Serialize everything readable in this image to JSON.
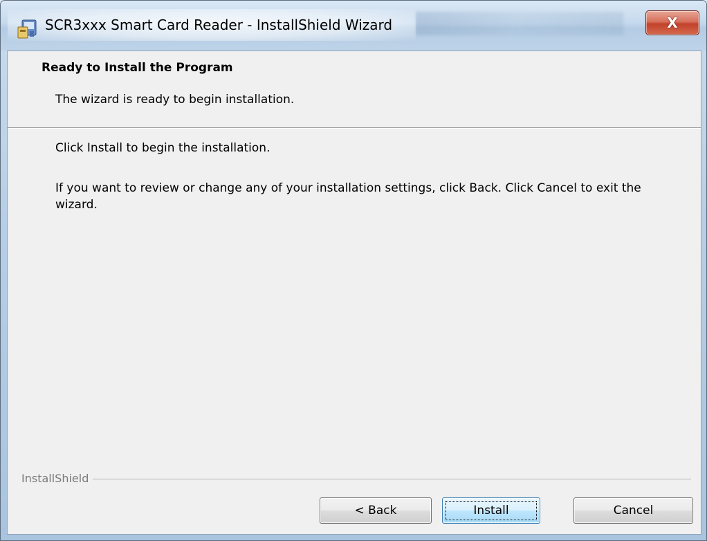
{
  "window": {
    "title": "SCR3xxx Smart Card Reader - InstallShield Wizard",
    "close_label": "X"
  },
  "header": {
    "title": "Ready to Install the Program",
    "subtitle": "The wizard is ready to begin installation."
  },
  "body": {
    "line1": "Click Install to begin the installation.",
    "line2": "If you want to review or change any of your installation settings, click Back. Click Cancel to exit the wizard."
  },
  "footer": {
    "brand": "InstallShield"
  },
  "buttons": {
    "back": "< Back",
    "install": "Install",
    "cancel": "Cancel"
  },
  "colors": {
    "titlebar": "#c5d9ed",
    "client_bg": "#f0f0f0",
    "close_red": "#c2412a",
    "default_button_border": "#3c7fb1"
  }
}
